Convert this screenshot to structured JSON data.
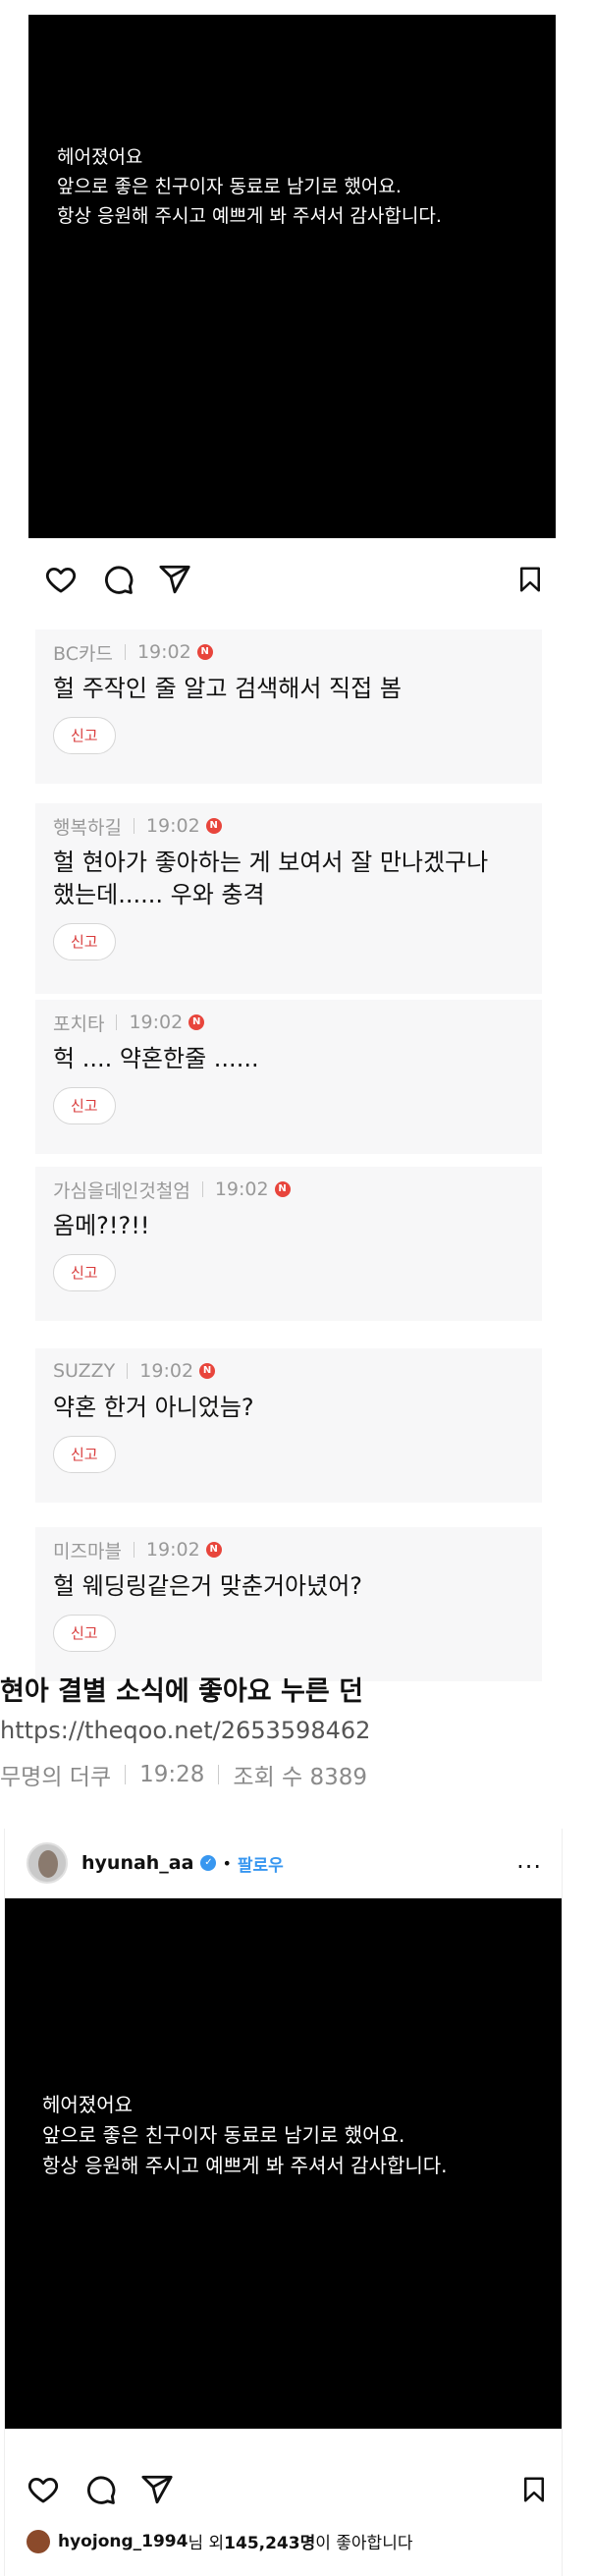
{
  "top_post": {
    "lines": [
      "헤어졌어요",
      "앞으로 좋은 친구이자 동료로 남기로 했어요.",
      "항상 응원해 주시고 예쁘게 봐 주셔서 감사합니다."
    ]
  },
  "icons": {
    "like": "heart-icon",
    "comment": "comment-icon",
    "share": "share-icon",
    "bookmark": "bookmark-icon",
    "new_badge": "N"
  },
  "comments": [
    {
      "author": "BC카드",
      "time": "19:02",
      "text": "헐 주작인 줄 알고 검색해서 직접 봄",
      "report": "신고"
    },
    {
      "author": "행복하길",
      "time": "19:02",
      "text": "헐 현아가 좋아하는 게 보여서 잘 만나겠구나",
      "text2": "했는데...... 우와 충격",
      "report": "신고"
    },
    {
      "author": "포치타",
      "time": "19:02",
      "text": "헉 .... 약혼한줄 ......",
      "report": "신고"
    },
    {
      "author": "가심을데인것철엄",
      "time": "19:02",
      "text": "옴메?!?!!",
      "report": "신고"
    },
    {
      "author": "SUZZY",
      "time": "19:02",
      "text": "약혼 한거 아니었늠?",
      "report": "신고"
    },
    {
      "author": "미즈마블",
      "time": "19:02",
      "text": "헐 웨딩링같은거 맞춘거아녔어?",
      "report": "신고"
    }
  ],
  "article": {
    "title": "현아 결별 소식에 좋아요 누른 던",
    "url": "https://theqoo.net/2653598462",
    "author": "무명의 더쿠",
    "time": "19:28",
    "views": "조회 수 8389"
  },
  "embed": {
    "username": "hyunah_aa",
    "dot": "•",
    "follow": "팔로우",
    "more": "...",
    "lines": [
      "헤어졌어요",
      "앞으로 좋은 친구이자 동료로 남기로 했어요.",
      "항상 응원해 주시고 예쁘게 봐 주셔서 감사합니다."
    ],
    "likes_user": "hyojong_1994",
    "likes_mid": "님 외 ",
    "likes_count": "145,243명",
    "likes_tail": "이 좋아합니다"
  },
  "colors": {
    "post_bg": "#000000",
    "comment_bg": "#f7f7f8",
    "report_text": "#d93b3b",
    "new_badge": "#e8453c",
    "follow_blue": "#3897f0"
  }
}
